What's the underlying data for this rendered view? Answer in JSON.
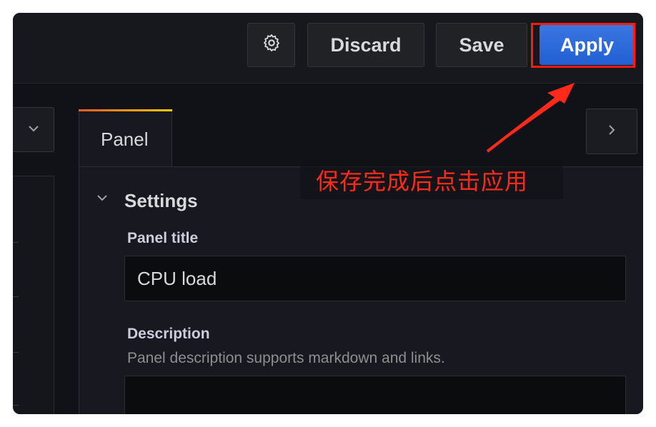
{
  "toolbar": {
    "settings_icon": "gear-icon",
    "discard_label": "Discard",
    "save_label": "Save",
    "apply_label": "Apply",
    "apply_color": "#3274d9",
    "highlight_color": "#ff1a0e"
  },
  "tabs": {
    "panel_label": "Panel",
    "left_collapse_icon": "chevron-down-icon",
    "right_collapse_icon": "chevron-right-icon"
  },
  "settings": {
    "section_title": "Settings",
    "section_icon": "chevron-down-icon",
    "panel_title_label": "Panel title",
    "panel_title_value": "CPU load",
    "description_label": "Description",
    "description_hint": "Panel description supports markdown and links.",
    "description_value": ""
  },
  "annotation": {
    "text": "保存完成后点击应用",
    "color": "#ff2a1a"
  }
}
